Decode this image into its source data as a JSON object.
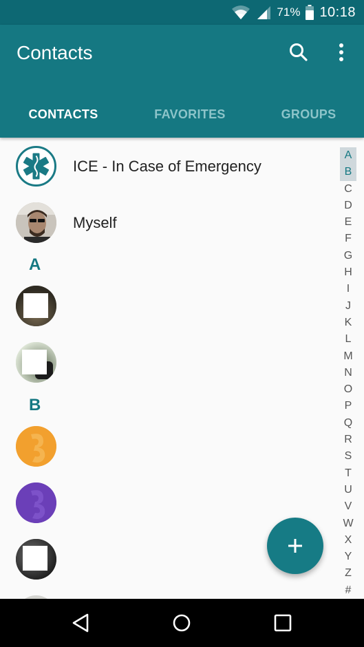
{
  "status_bar": {
    "battery_percent": "71%",
    "time": "10:18",
    "icons": [
      "wifi-icon",
      "signal-icon",
      "battery-icon"
    ]
  },
  "app_bar": {
    "title": "Contacts",
    "icons": [
      "search-icon",
      "overflow-menu-icon"
    ],
    "color": "#157882"
  },
  "tabs": [
    {
      "label": "CONTACTS",
      "active": true
    },
    {
      "label": "FAVORITES",
      "active": false
    },
    {
      "label": "GROUPS",
      "active": false
    }
  ],
  "contacts": {
    "pinned": [
      {
        "name": "ICE - In Case of Emergency",
        "avatar": "medical-star-icon"
      },
      {
        "name": "Myself",
        "avatar": "profile-photo"
      }
    ],
    "sections": [
      {
        "header": "A"
      },
      {
        "header": "B"
      }
    ]
  },
  "alphabet": [
    "A",
    "B",
    "C",
    "D",
    "E",
    "F",
    "G",
    "H",
    "I",
    "J",
    "K",
    "L",
    "M",
    "N",
    "O",
    "P",
    "Q",
    "R",
    "S",
    "T",
    "U",
    "V",
    "W",
    "X",
    "Y",
    "Z",
    "#"
  ],
  "fab": {
    "icon": "plus-icon"
  },
  "nav_bar": {
    "icons": [
      "back-icon",
      "home-icon",
      "recents-icon"
    ]
  }
}
